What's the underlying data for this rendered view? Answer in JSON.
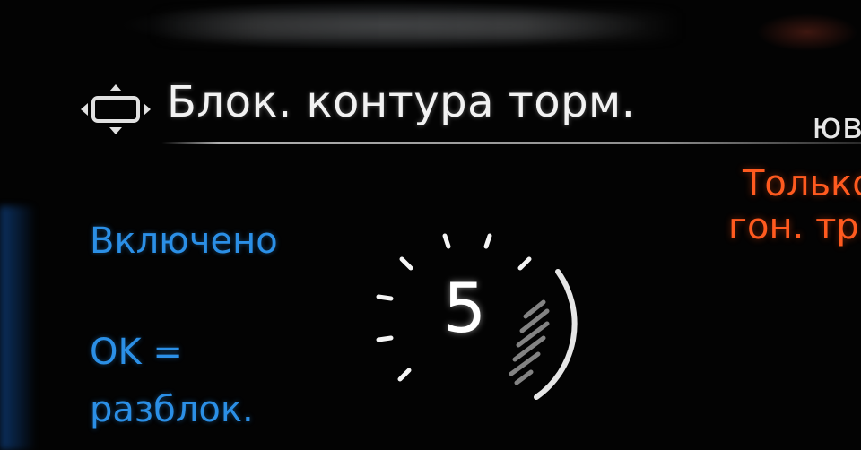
{
  "header": {
    "title": "Блок. контура торм.",
    "side_label": "юв",
    "nav_icon": "dpad-navigation-icon"
  },
  "warning": {
    "line1": "Только",
    "line2": "гон. тр.",
    "color": "#ff5a1f"
  },
  "status": {
    "text": "Включено",
    "color": "#2b8fe6"
  },
  "hint": {
    "line1": "OK =",
    "line2": "разблок."
  },
  "countdown": {
    "value": "5"
  }
}
